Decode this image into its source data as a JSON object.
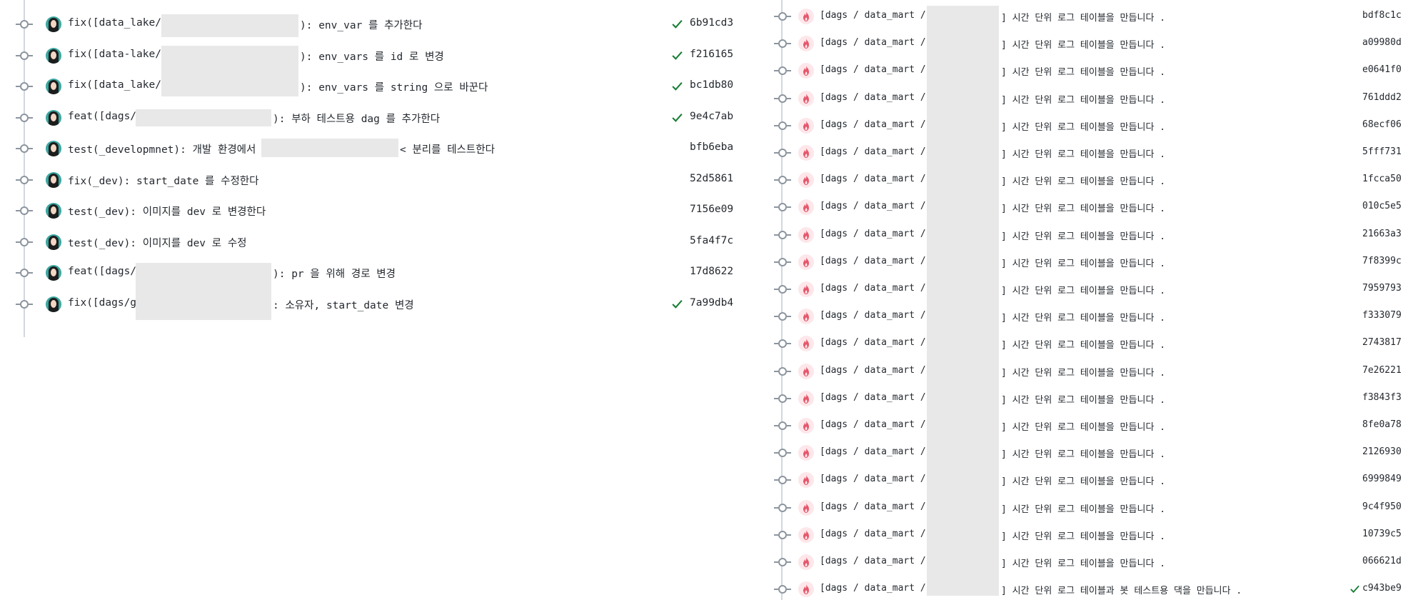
{
  "left_commits": [
    {
      "prefix": "fix([data_lake/",
      "suffix": "): env_var 를 추가한다",
      "sha": "6b91cd3",
      "checked": true
    },
    {
      "prefix": "fix([data-lake/",
      "suffix": "): env_vars 를 id 로 변경",
      "sha": "f216165",
      "checked": true
    },
    {
      "prefix": "fix([data_lake/",
      "suffix": "): env_vars 를 string 으로 바꾼다",
      "sha": "bc1db80",
      "checked": true
    },
    {
      "prefix": "feat([dags/",
      "suffix": "): 부하 테스트용 dag 를 추가한다",
      "sha": "9e4c7ab",
      "checked": true
    },
    {
      "prefix": "test(_developmnet): 개발 환경에서 r",
      "suffix": "< 분리를 테스트한다",
      "sha": "bfb6eba",
      "checked": false
    },
    {
      "prefix": "fix(_dev): start_date 를 수정한다",
      "suffix": "",
      "sha": "52d5861",
      "checked": false
    },
    {
      "prefix": "test(_dev): 이미지를 dev 로 변경한다",
      "suffix": "",
      "sha": "7156e09",
      "checked": false
    },
    {
      "prefix": "test(_dev): 이미지를 dev 로 수정",
      "suffix": "",
      "sha": "5fa4f7c",
      "checked": false
    },
    {
      "prefix": "feat([dags/",
      "suffix": "): pr 을 위해 경로 변경",
      "sha": "17d8622",
      "checked": false
    },
    {
      "prefix": "fix([dags/g",
      "suffix": ": 소유자, start_date 변경",
      "sha": "7a99db4",
      "checked": true
    }
  ],
  "right_commits": [
    {
      "prefix": "[dags / data_mart /",
      "suffix": "] 시간 단위 로그 테이블을 만듭니다 .",
      "sha": "bdf8c1c",
      "checked": false
    },
    {
      "prefix": "[dags / data_mart /",
      "suffix": "] 시간 단위 로그 테이블을 만듭니다 .",
      "sha": "a09980d",
      "checked": false
    },
    {
      "prefix": "[dags / data_mart /",
      "suffix": "] 시간 단위 로그 테이블을 만듭니다 .",
      "sha": "e0641f0",
      "checked": false
    },
    {
      "prefix": "[dags / data_mart /",
      "suffix": "] 시간 단위 로그 테이블을 만듭니다 .",
      "sha": "761ddd2",
      "checked": false
    },
    {
      "prefix": "[dags / data_mart /",
      "suffix": "] 시간 단위 로그 테이블을 만듭니다 .",
      "sha": "68ecf06",
      "checked": false
    },
    {
      "prefix": "[dags / data_mart /",
      "suffix": "] 시간 단위 로그 테이블을 만듭니다 .",
      "sha": "5fff731",
      "checked": false
    },
    {
      "prefix": "[dags / data_mart /",
      "suffix": "] 시간 단위 로그 테이블을 만듭니다 .",
      "sha": "1fcca50",
      "checked": false
    },
    {
      "prefix": "[dags / data_mart /",
      "suffix": "] 시간 단위 로그 테이블을 만듭니다 .",
      "sha": "010c5e5",
      "checked": false
    },
    {
      "prefix": "[dags / data_mart /",
      "suffix": "] 시간 단위 로그 테이블을 만듭니다 .",
      "sha": "21663a3",
      "checked": false
    },
    {
      "prefix": "[dags / data_mart /",
      "suffix": "] 시간 단위 로그 테이블을 만듭니다 .",
      "sha": "7f8399c",
      "checked": false
    },
    {
      "prefix": "[dags / data_mart /",
      "suffix": "] 시간 단위 로그 테이블을 만듭니다 .",
      "sha": "7959793",
      "checked": false
    },
    {
      "prefix": "[dags / data_mart /",
      "suffix": "] 시간 단위 로그 테이블을 만듭니다 .",
      "sha": "f333079",
      "checked": false
    },
    {
      "prefix": "[dags / data_mart /",
      "suffix": "] 시간 단위 로그 테이블을 만듭니다 .",
      "sha": "2743817",
      "checked": false
    },
    {
      "prefix": "[dags / data_mart /",
      "suffix": "] 시간 단위 로그 테이블을 만듭니다 .",
      "sha": "7e26221",
      "checked": false
    },
    {
      "prefix": "[dags / data_mart /",
      "suffix": "] 시간 단위 로그 테이블을 만듭니다 .",
      "sha": "f3843f3",
      "checked": false
    },
    {
      "prefix": "[dags / data_mart /",
      "suffix": "] 시간 단위 로그 테이블을 만듭니다 .",
      "sha": "8fe0a78",
      "checked": false
    },
    {
      "prefix": "[dags / data_mart /",
      "suffix": "] 시간 단위 로그 테이블을 만듭니다 .",
      "sha": "2126930",
      "checked": false
    },
    {
      "prefix": "[dags / data_mart /",
      "suffix": "] 시간 단위 로그 테이블을 만듭니다 .",
      "sha": "6999849",
      "checked": false
    },
    {
      "prefix": "[dags / data_mart /",
      "suffix": "] 시간 단위 로그 테이블을 만듭니다 .",
      "sha": "9c4f950",
      "checked": false
    },
    {
      "prefix": "[dags / data_mart /",
      "suffix": "] 시간 단위 로그 테이블을 만듭니다 .",
      "sha": "10739c5",
      "checked": false
    },
    {
      "prefix": "[dags / data_mart /",
      "suffix": "] 시간 단위 로그 테이블을 만듭니다 .",
      "sha": "066621d",
      "checked": false
    },
    {
      "prefix": "[dags / data_mart /",
      "suffix": "] 시간 단위 로그 테이블과 봇 테스트용 댁을 만듭니다 .",
      "sha": "c943be9",
      "checked": true
    }
  ],
  "colors": {
    "check": "#1a7f37",
    "node": "#8c959f",
    "line": "#d0d7de",
    "redaction": "#e8e8e8",
    "avatar_left": "#3aa7a0",
    "avatar_right": "#e5576b"
  },
  "icons": {
    "left_avatar": "user-avatar-icon",
    "right_avatar": "fire-avatar-icon",
    "check": "check-icon",
    "node": "commit-node-icon"
  }
}
